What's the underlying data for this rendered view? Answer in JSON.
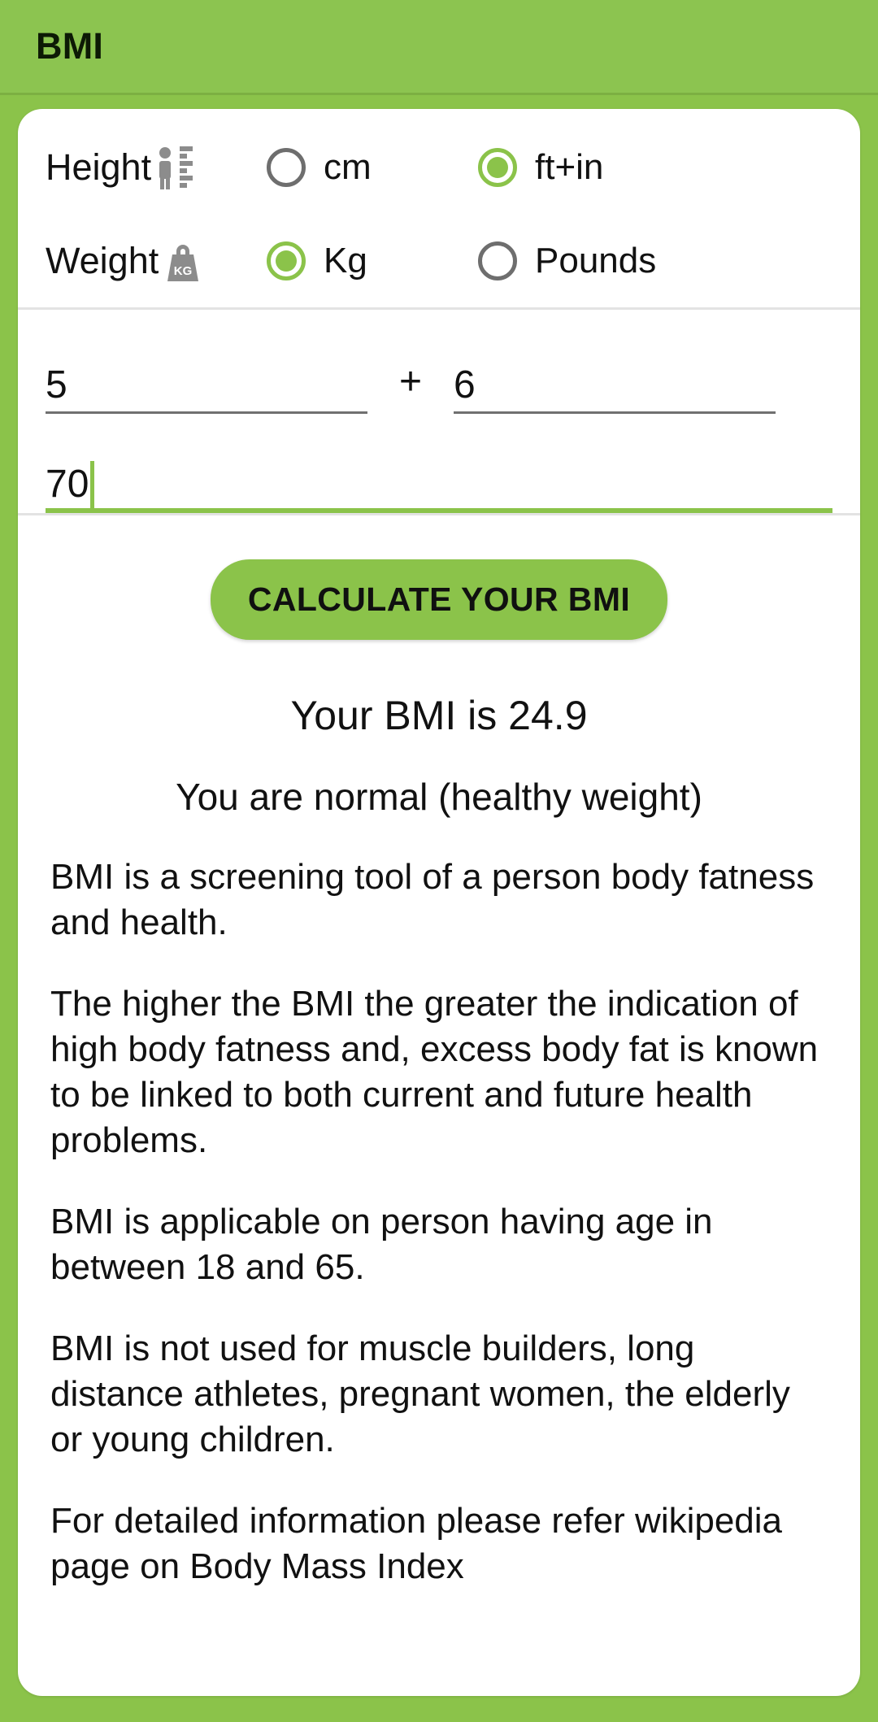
{
  "app": {
    "title": "BMI",
    "accent_color": "#8BC34A",
    "card_color": "#FFFFFF",
    "text_color": "#111111"
  },
  "units": {
    "height": {
      "label": "Height",
      "icon": "person-ruler-icon",
      "options": [
        {
          "label": "cm",
          "selected": false
        },
        {
          "label": "ft+in",
          "selected": true
        }
      ]
    },
    "weight": {
      "label": "Weight",
      "icon": "kettlebell-kg-icon",
      "options": [
        {
          "label": "Kg",
          "selected": true
        },
        {
          "label": "Pounds",
          "selected": false
        }
      ]
    }
  },
  "inputs": {
    "feet": {
      "value": "5",
      "focused": false
    },
    "plus": "+",
    "inches": {
      "value": "6",
      "focused": false
    },
    "weight": {
      "value": "70",
      "focused": true
    }
  },
  "actions": {
    "calculate_label": "CALCULATE YOUR BMI"
  },
  "result": {
    "bmi_line": "Your BMI is 24.9",
    "bmi_value": "24.9",
    "category_line": "You are normal (healthy weight)"
  },
  "info": {
    "paragraphs": [
      "BMI is a screening tool of a person body fatness and health.",
      "The higher the BMI the greater the indication of high body fatness and, excess body fat is known to be linked to both current and future health problems.",
      "BMI is applicable on person having age in between 18 and 65.",
      "BMI is not used for muscle builders, long distance athletes, pregnant women, the elderly or young children.",
      "For detailed information please refer wikipedia page on Body Mass Index"
    ]
  }
}
